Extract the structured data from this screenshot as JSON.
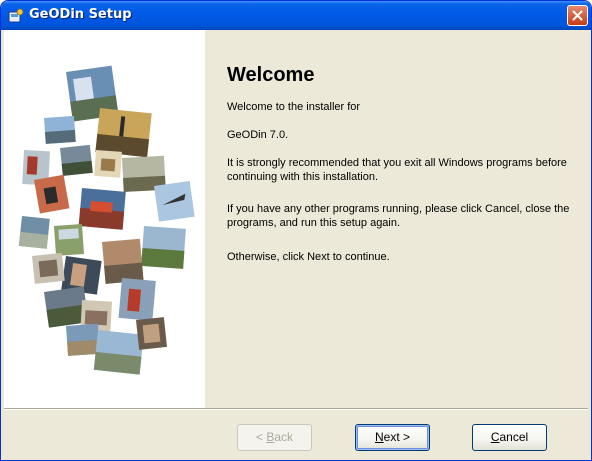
{
  "window": {
    "title": "GeODin Setup",
    "icons": {
      "app": "installer-icon",
      "close": "close-icon"
    },
    "colors": {
      "titlebar": "#0058e6",
      "close": "#c73b16",
      "face": "#ece9d8"
    }
  },
  "side_panel": {
    "image": "photo-collage"
  },
  "content": {
    "heading": "Welcome",
    "intro": "Welcome to the installer for",
    "product": "GeODin 7.0.",
    "recommend": "It is strongly recommended that you exit all Windows programs before continuing with this installation.",
    "running": "If you have any other programs running, please click Cancel, close the programs, and run this setup again.",
    "otherwise": "Otherwise, click Next to continue."
  },
  "buttons": {
    "back": {
      "label_before": "< ",
      "accel": "B",
      "label_after": "ack"
    },
    "next": {
      "accel": "N",
      "label_after": "ext >"
    },
    "cancel": {
      "accel": "C",
      "label_after": "ancel"
    }
  }
}
